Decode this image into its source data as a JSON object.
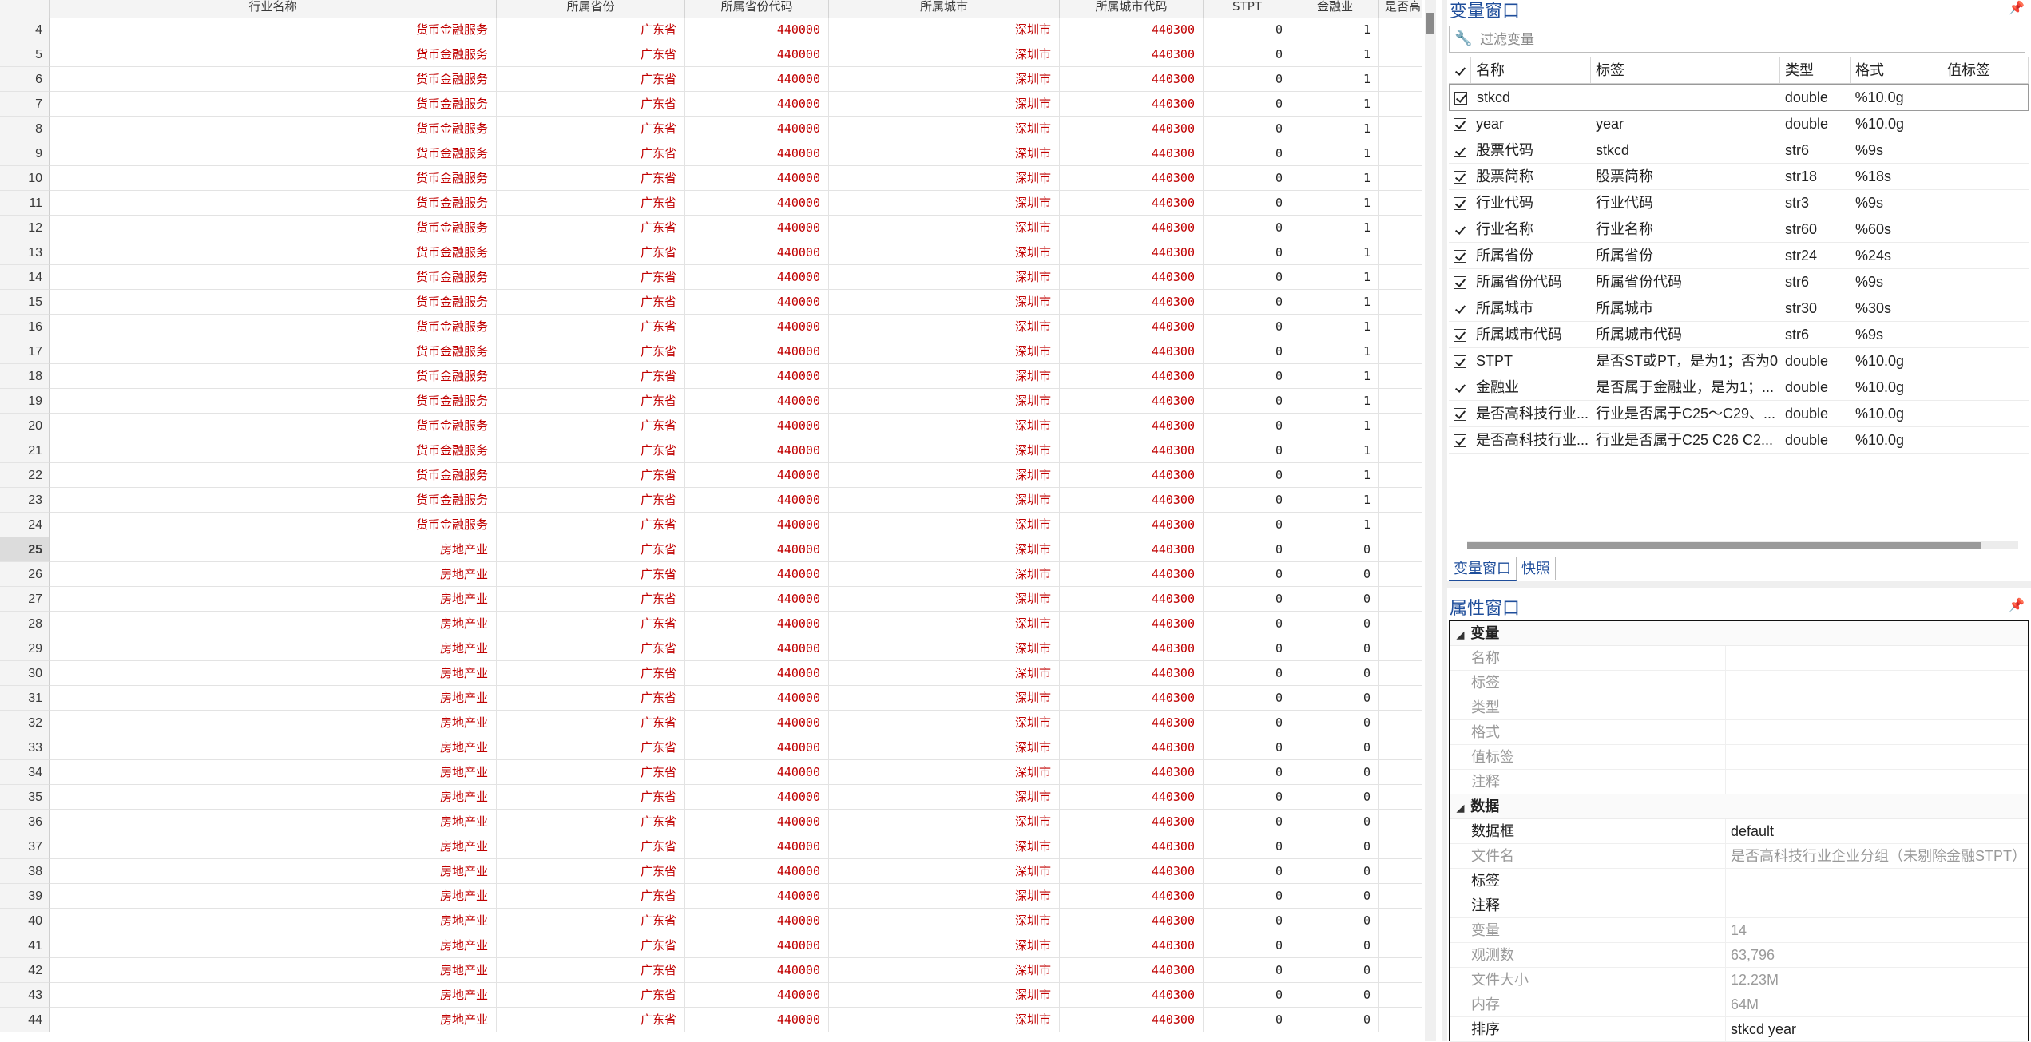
{
  "grid": {
    "columns": [
      {
        "label": "",
        "width": 62
      },
      {
        "label": "行业名称",
        "width": 560
      },
      {
        "label": "所属省份",
        "width": 236
      },
      {
        "label": "所属省份代码",
        "width": 180
      },
      {
        "label": "所属城市",
        "width": 289
      },
      {
        "label": "所属城市代码",
        "width": 180
      },
      {
        "label": "STPT",
        "width": 110
      },
      {
        "label": "金融业",
        "width": 110
      },
      {
        "label": "是否高",
        "width": 60
      }
    ],
    "selected_row": "25",
    "rows": [
      {
        "n": "4",
        "ind": "货币金融服务",
        "prov": "广东省",
        "pcode": "440000",
        "city": "深圳市",
        "ccode": "440300",
        "stpt": "0",
        "fin": "1"
      },
      {
        "n": "5",
        "ind": "货币金融服务",
        "prov": "广东省",
        "pcode": "440000",
        "city": "深圳市",
        "ccode": "440300",
        "stpt": "0",
        "fin": "1"
      },
      {
        "n": "6",
        "ind": "货币金融服务",
        "prov": "广东省",
        "pcode": "440000",
        "city": "深圳市",
        "ccode": "440300",
        "stpt": "0",
        "fin": "1"
      },
      {
        "n": "7",
        "ind": "货币金融服务",
        "prov": "广东省",
        "pcode": "440000",
        "city": "深圳市",
        "ccode": "440300",
        "stpt": "0",
        "fin": "1"
      },
      {
        "n": "8",
        "ind": "货币金融服务",
        "prov": "广东省",
        "pcode": "440000",
        "city": "深圳市",
        "ccode": "440300",
        "stpt": "0",
        "fin": "1"
      },
      {
        "n": "9",
        "ind": "货币金融服务",
        "prov": "广东省",
        "pcode": "440000",
        "city": "深圳市",
        "ccode": "440300",
        "stpt": "0",
        "fin": "1"
      },
      {
        "n": "10",
        "ind": "货币金融服务",
        "prov": "广东省",
        "pcode": "440000",
        "city": "深圳市",
        "ccode": "440300",
        "stpt": "0",
        "fin": "1"
      },
      {
        "n": "11",
        "ind": "货币金融服务",
        "prov": "广东省",
        "pcode": "440000",
        "city": "深圳市",
        "ccode": "440300",
        "stpt": "0",
        "fin": "1"
      },
      {
        "n": "12",
        "ind": "货币金融服务",
        "prov": "广东省",
        "pcode": "440000",
        "city": "深圳市",
        "ccode": "440300",
        "stpt": "0",
        "fin": "1"
      },
      {
        "n": "13",
        "ind": "货币金融服务",
        "prov": "广东省",
        "pcode": "440000",
        "city": "深圳市",
        "ccode": "440300",
        "stpt": "0",
        "fin": "1"
      },
      {
        "n": "14",
        "ind": "货币金融服务",
        "prov": "广东省",
        "pcode": "440000",
        "city": "深圳市",
        "ccode": "440300",
        "stpt": "0",
        "fin": "1"
      },
      {
        "n": "15",
        "ind": "货币金融服务",
        "prov": "广东省",
        "pcode": "440000",
        "city": "深圳市",
        "ccode": "440300",
        "stpt": "0",
        "fin": "1"
      },
      {
        "n": "16",
        "ind": "货币金融服务",
        "prov": "广东省",
        "pcode": "440000",
        "city": "深圳市",
        "ccode": "440300",
        "stpt": "0",
        "fin": "1"
      },
      {
        "n": "17",
        "ind": "货币金融服务",
        "prov": "广东省",
        "pcode": "440000",
        "city": "深圳市",
        "ccode": "440300",
        "stpt": "0",
        "fin": "1"
      },
      {
        "n": "18",
        "ind": "货币金融服务",
        "prov": "广东省",
        "pcode": "440000",
        "city": "深圳市",
        "ccode": "440300",
        "stpt": "0",
        "fin": "1"
      },
      {
        "n": "19",
        "ind": "货币金融服务",
        "prov": "广东省",
        "pcode": "440000",
        "city": "深圳市",
        "ccode": "440300",
        "stpt": "0",
        "fin": "1"
      },
      {
        "n": "20",
        "ind": "货币金融服务",
        "prov": "广东省",
        "pcode": "440000",
        "city": "深圳市",
        "ccode": "440300",
        "stpt": "0",
        "fin": "1"
      },
      {
        "n": "21",
        "ind": "货币金融服务",
        "prov": "广东省",
        "pcode": "440000",
        "city": "深圳市",
        "ccode": "440300",
        "stpt": "0",
        "fin": "1"
      },
      {
        "n": "22",
        "ind": "货币金融服务",
        "prov": "广东省",
        "pcode": "440000",
        "city": "深圳市",
        "ccode": "440300",
        "stpt": "0",
        "fin": "1"
      },
      {
        "n": "23",
        "ind": "货币金融服务",
        "prov": "广东省",
        "pcode": "440000",
        "city": "深圳市",
        "ccode": "440300",
        "stpt": "0",
        "fin": "1"
      },
      {
        "n": "24",
        "ind": "货币金融服务",
        "prov": "广东省",
        "pcode": "440000",
        "city": "深圳市",
        "ccode": "440300",
        "stpt": "0",
        "fin": "1"
      },
      {
        "n": "25",
        "ind": "房地产业",
        "prov": "广东省",
        "pcode": "440000",
        "city": "深圳市",
        "ccode": "440300",
        "stpt": "0",
        "fin": "0"
      },
      {
        "n": "26",
        "ind": "房地产业",
        "prov": "广东省",
        "pcode": "440000",
        "city": "深圳市",
        "ccode": "440300",
        "stpt": "0",
        "fin": "0"
      },
      {
        "n": "27",
        "ind": "房地产业",
        "prov": "广东省",
        "pcode": "440000",
        "city": "深圳市",
        "ccode": "440300",
        "stpt": "0",
        "fin": "0"
      },
      {
        "n": "28",
        "ind": "房地产业",
        "prov": "广东省",
        "pcode": "440000",
        "city": "深圳市",
        "ccode": "440300",
        "stpt": "0",
        "fin": "0"
      },
      {
        "n": "29",
        "ind": "房地产业",
        "prov": "广东省",
        "pcode": "440000",
        "city": "深圳市",
        "ccode": "440300",
        "stpt": "0",
        "fin": "0"
      },
      {
        "n": "30",
        "ind": "房地产业",
        "prov": "广东省",
        "pcode": "440000",
        "city": "深圳市",
        "ccode": "440300",
        "stpt": "0",
        "fin": "0"
      },
      {
        "n": "31",
        "ind": "房地产业",
        "prov": "广东省",
        "pcode": "440000",
        "city": "深圳市",
        "ccode": "440300",
        "stpt": "0",
        "fin": "0"
      },
      {
        "n": "32",
        "ind": "房地产业",
        "prov": "广东省",
        "pcode": "440000",
        "city": "深圳市",
        "ccode": "440300",
        "stpt": "0",
        "fin": "0"
      },
      {
        "n": "33",
        "ind": "房地产业",
        "prov": "广东省",
        "pcode": "440000",
        "city": "深圳市",
        "ccode": "440300",
        "stpt": "0",
        "fin": "0"
      },
      {
        "n": "34",
        "ind": "房地产业",
        "prov": "广东省",
        "pcode": "440000",
        "city": "深圳市",
        "ccode": "440300",
        "stpt": "0",
        "fin": "0"
      },
      {
        "n": "35",
        "ind": "房地产业",
        "prov": "广东省",
        "pcode": "440000",
        "city": "深圳市",
        "ccode": "440300",
        "stpt": "0",
        "fin": "0"
      },
      {
        "n": "36",
        "ind": "房地产业",
        "prov": "广东省",
        "pcode": "440000",
        "city": "深圳市",
        "ccode": "440300",
        "stpt": "0",
        "fin": "0"
      },
      {
        "n": "37",
        "ind": "房地产业",
        "prov": "广东省",
        "pcode": "440000",
        "city": "深圳市",
        "ccode": "440300",
        "stpt": "0",
        "fin": "0"
      },
      {
        "n": "38",
        "ind": "房地产业",
        "prov": "广东省",
        "pcode": "440000",
        "city": "深圳市",
        "ccode": "440300",
        "stpt": "0",
        "fin": "0"
      },
      {
        "n": "39",
        "ind": "房地产业",
        "prov": "广东省",
        "pcode": "440000",
        "city": "深圳市",
        "ccode": "440300",
        "stpt": "0",
        "fin": "0"
      },
      {
        "n": "40",
        "ind": "房地产业",
        "prov": "广东省",
        "pcode": "440000",
        "city": "深圳市",
        "ccode": "440300",
        "stpt": "0",
        "fin": "0"
      },
      {
        "n": "41",
        "ind": "房地产业",
        "prov": "广东省",
        "pcode": "440000",
        "city": "深圳市",
        "ccode": "440300",
        "stpt": "0",
        "fin": "0"
      },
      {
        "n": "42",
        "ind": "房地产业",
        "prov": "广东省",
        "pcode": "440000",
        "city": "深圳市",
        "ccode": "440300",
        "stpt": "0",
        "fin": "0"
      },
      {
        "n": "43",
        "ind": "房地产业",
        "prov": "广东省",
        "pcode": "440000",
        "city": "深圳市",
        "ccode": "440300",
        "stpt": "0",
        "fin": "0"
      },
      {
        "n": "44",
        "ind": "房地产业",
        "prov": "广东省",
        "pcode": "440000",
        "city": "深圳市",
        "ccode": "440300",
        "stpt": "0",
        "fin": "0"
      }
    ]
  },
  "variables_window": {
    "title": "变量窗口",
    "pin_icon": "pin-icon",
    "filter_icon": "wrench-icon",
    "filter_placeholder": "过滤变量",
    "headers": {
      "name": "名称",
      "label": "标签",
      "type": "类型",
      "format": "格式",
      "value_label": "值标签"
    },
    "rows": [
      {
        "name": "stkcd",
        "label": "",
        "type": "double",
        "format": "%10.0g"
      },
      {
        "name": "year",
        "label": "year",
        "type": "double",
        "format": "%10.0g"
      },
      {
        "name": "股票代码",
        "label": "stkcd",
        "type": "str6",
        "format": "%9s"
      },
      {
        "name": "股票简称",
        "label": "股票简称",
        "type": "str18",
        "format": "%18s"
      },
      {
        "name": "行业代码",
        "label": "行业代码",
        "type": "str3",
        "format": "%9s"
      },
      {
        "name": "行业名称",
        "label": "行业名称",
        "type": "str60",
        "format": "%60s"
      },
      {
        "name": "所属省份",
        "label": "所属省份",
        "type": "str24",
        "format": "%24s"
      },
      {
        "name": "所属省份代码",
        "label": "所属省份代码",
        "type": "str6",
        "format": "%9s"
      },
      {
        "name": "所属城市",
        "label": "所属城市",
        "type": "str30",
        "format": "%30s"
      },
      {
        "name": "所属城市代码",
        "label": "所属城市代码",
        "type": "str6",
        "format": "%9s"
      },
      {
        "name": "STPT",
        "label": "是否ST或PT，是为1；否为0",
        "type": "double",
        "format": "%10.0g"
      },
      {
        "name": "金融业",
        "label": "是否属于金融业，是为1；...",
        "type": "double",
        "format": "%10.0g"
      },
      {
        "name": "是否高科技行业...",
        "label": "行业是否属于C25～C29、...",
        "type": "double",
        "format": "%10.0g"
      },
      {
        "name": "是否高科技行业...",
        "label": "行业是否属于C25 C26 C2...",
        "type": "double",
        "format": "%10.0g"
      }
    ],
    "tabs": [
      "变量窗口",
      "快照"
    ]
  },
  "properties_window": {
    "title": "属性窗口",
    "pin_icon": "pin-icon",
    "groups": [
      {
        "title": "变量",
        "rows": [
          {
            "key": "名称",
            "value": "",
            "dim": true
          },
          {
            "key": "标签",
            "value": "",
            "dim": true
          },
          {
            "key": "类型",
            "value": "",
            "dim": true
          },
          {
            "key": "格式",
            "value": "",
            "dim": true
          },
          {
            "key": "值标签",
            "value": "",
            "dim": true
          },
          {
            "key": "注释",
            "value": "",
            "dim": true
          }
        ]
      },
      {
        "title": "数据",
        "rows": [
          {
            "key": "数据框",
            "value": "default",
            "dim": false
          },
          {
            "key": "文件名",
            "value": "是否高科技行业企业分组（未剔除金融STPT）",
            "dim": true
          },
          {
            "key": "标签",
            "value": "",
            "dim": false
          },
          {
            "key": "注释",
            "value": "",
            "dim": false
          },
          {
            "key": "变量",
            "value": "14",
            "dim": true
          },
          {
            "key": "观测数",
            "value": "63,796",
            "dim": true
          },
          {
            "key": "文件大小",
            "value": "12.23M",
            "dim": true
          },
          {
            "key": "内存",
            "value": "64M",
            "dim": true
          },
          {
            "key": "排序",
            "value": "stkcd year",
            "dim": false
          }
        ]
      }
    ]
  }
}
